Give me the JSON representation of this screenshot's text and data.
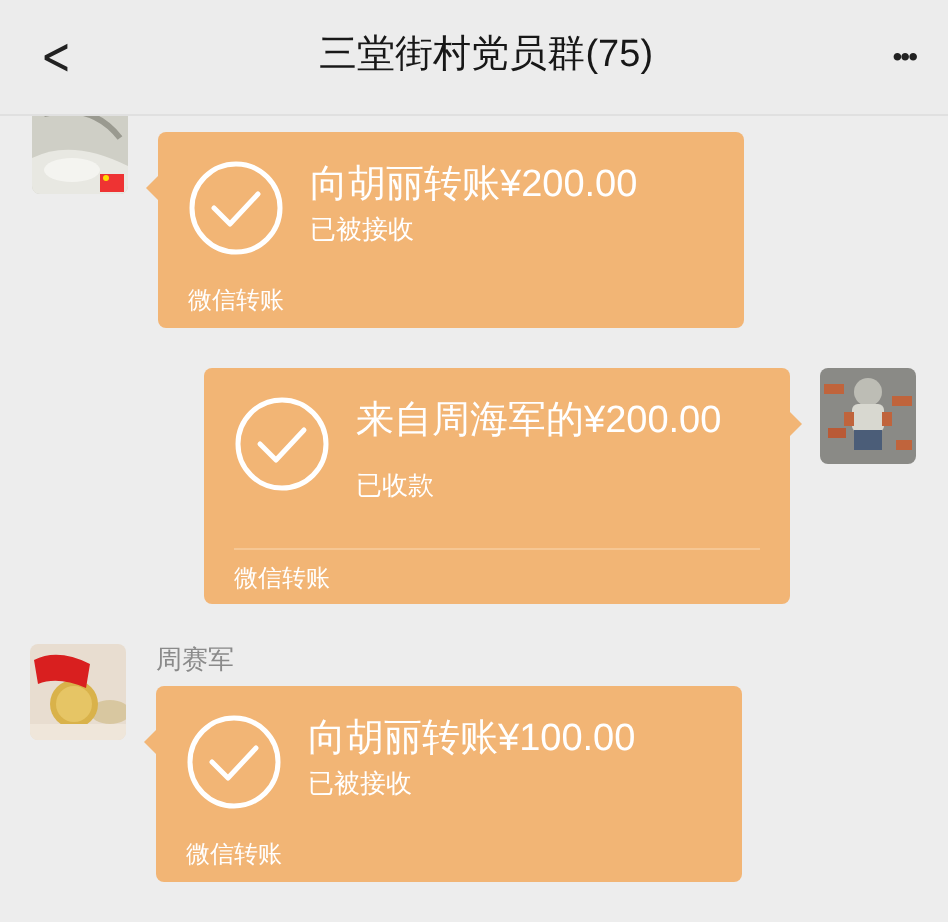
{
  "header": {
    "back": "<",
    "title": "三堂街村党员群(75)",
    "more": "•••"
  },
  "messages": [
    {
      "kind": "incoming",
      "title": "向胡丽转账¥200.00",
      "status": "已被接收",
      "footer": "微信转账"
    },
    {
      "kind": "outgoing",
      "title": "来自周海军的¥200.00",
      "status": "已收款",
      "footer": "微信转账"
    },
    {
      "kind": "incoming",
      "sender": "周赛军",
      "title": "向胡丽转账¥100.00",
      "status": "已被接收",
      "footer": "微信转账"
    }
  ]
}
